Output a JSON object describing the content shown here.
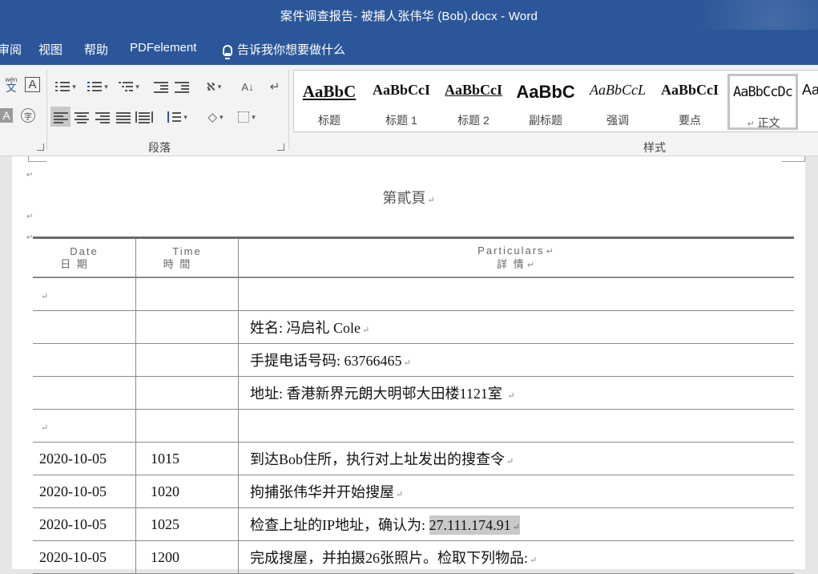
{
  "window": {
    "title": "案件调查报告- 被捕人张伟华 (Bob).docx  -  Word"
  },
  "menu": {
    "items": [
      "审阅",
      "视图",
      "帮助",
      "PDFelement"
    ],
    "tell_me": "告诉我你想要做什么"
  },
  "ribbon": {
    "paragraph_label": "段落",
    "styles_label": "样式",
    "styles": [
      {
        "preview": "AaBbC",
        "name": "标题"
      },
      {
        "preview": "AaBbCcI",
        "name": "标题 1"
      },
      {
        "preview": "AaBbCcI",
        "name": "标题 2"
      },
      {
        "preview": "AaBbC",
        "name": "副标题"
      },
      {
        "preview": "AaBbCcL",
        "name": "强调"
      },
      {
        "preview": "AaBbCcI",
        "name": "要点"
      },
      {
        "preview": "AaBbCcDc",
        "name": "正文"
      },
      {
        "preview": "Aa",
        "name": ""
      }
    ],
    "font_glyphs": {
      "wen": "wén",
      "wen_char": "文",
      "boxed_a": "A",
      "shaded_a": "A",
      "circled": "字"
    }
  },
  "document": {
    "page_header": "第貳頁",
    "table": {
      "headers": [
        {
          "en": "Date",
          "zh": "日 期"
        },
        {
          "en": "Time",
          "zh": "時 間"
        },
        {
          "en": "Particulars",
          "zh": "詳 情"
        }
      ],
      "rows": [
        {
          "date": "",
          "time": "",
          "details": ""
        },
        {
          "date": "",
          "time": "",
          "details": "姓名: 冯启礼  Cole"
        },
        {
          "date": "",
          "time": "",
          "details": "手提电话号码: 63766465"
        },
        {
          "date": "",
          "time": "",
          "details": "地址: 香港新界元朗大明邨大田楼1121室"
        },
        {
          "date": "",
          "time": "",
          "details": ""
        },
        {
          "date": "2020-10-05",
          "time": "1015",
          "details": "到达Bob住所，执行对上址发出的搜查令"
        },
        {
          "date": "2020-10-05",
          "time": "1020",
          "details": "拘捕张伟华并开始搜屋"
        },
        {
          "date": "2020-10-05",
          "time": "1025",
          "details": "检查上址的IP地址，确认为: ",
          "highlight": "27.111.174.91"
        },
        {
          "date": "2020-10-05",
          "time": "1200",
          "details": "完成搜屋，并拍摄26张照片。检取下列物品:"
        }
      ]
    }
  },
  "colors": {
    "title_bar": "#2b579a",
    "ribbon": "#f3f3f3",
    "selection": "#c9c9c9"
  }
}
